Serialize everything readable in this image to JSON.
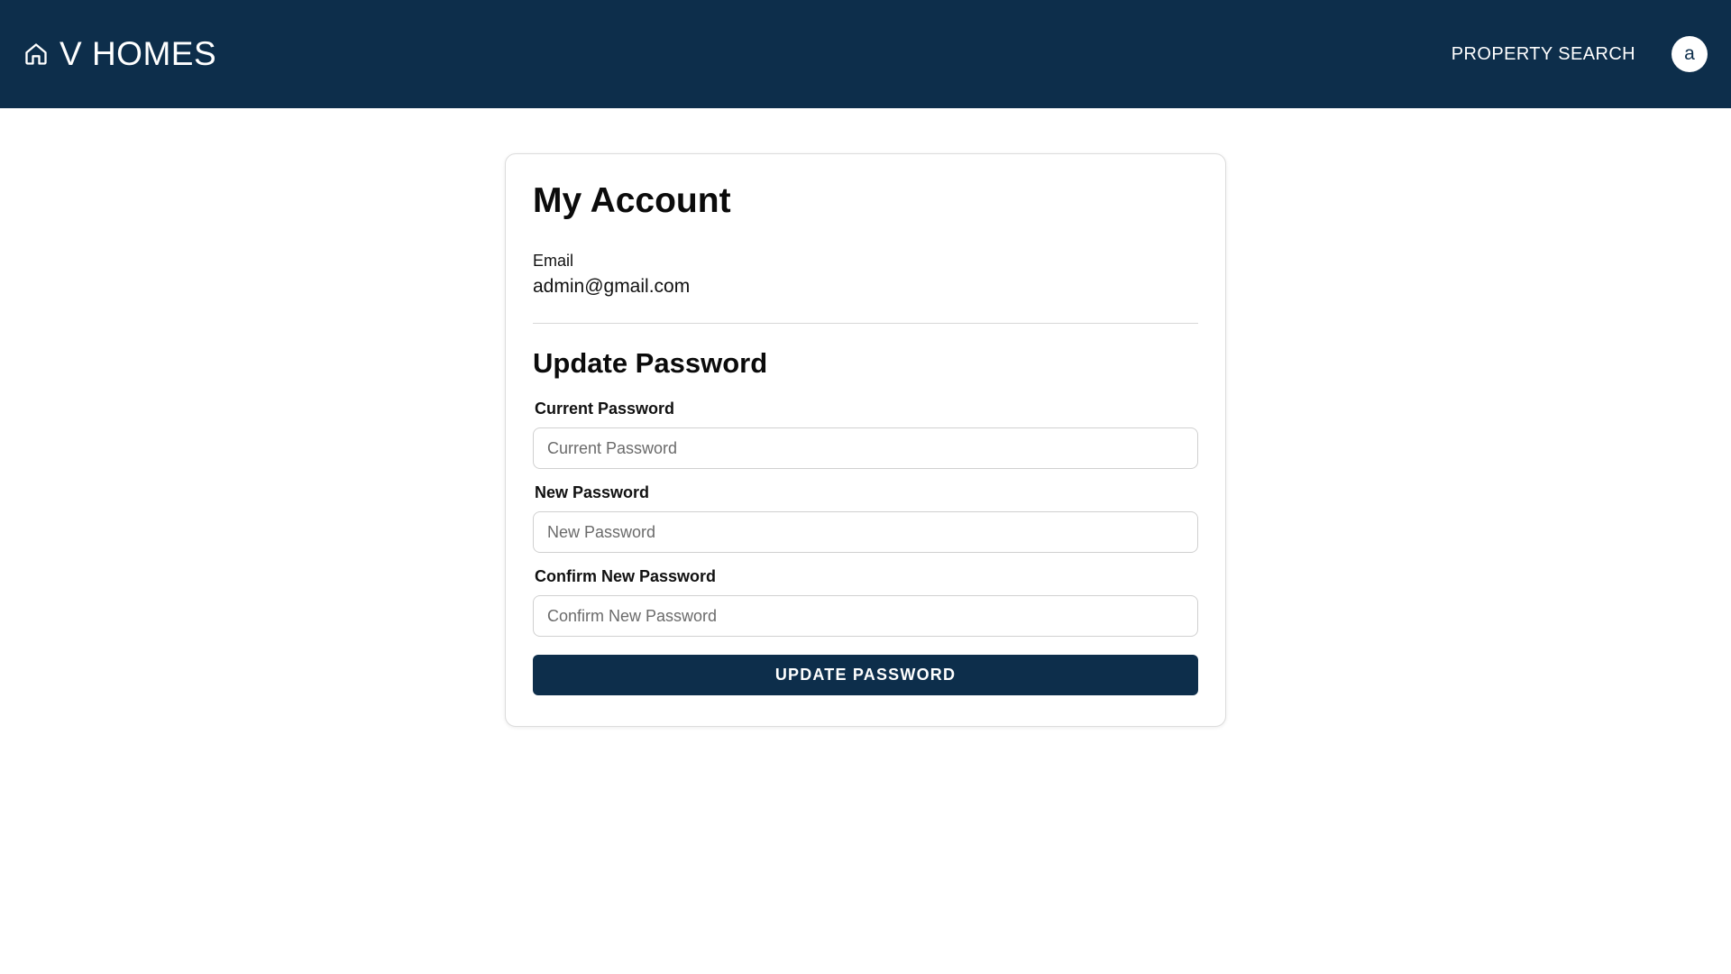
{
  "header": {
    "brand": "V HOMES",
    "brand_icon": "home-icon",
    "nav_link": "PROPERTY SEARCH",
    "avatar_initial": "a"
  },
  "colors": {
    "navbar": "#0d2e4b",
    "button": "#0d2e4b",
    "page_background": "#ffffff"
  },
  "account": {
    "title": "My Account",
    "email_label": "Email",
    "email_value": "admin@gmail.com"
  },
  "password_form": {
    "title": "Update Password",
    "fields": [
      {
        "label": "Current Password",
        "placeholder": "Current Password",
        "value": ""
      },
      {
        "label": "New Password",
        "placeholder": "New Password",
        "value": ""
      },
      {
        "label": "Confirm New Password",
        "placeholder": "Confirm New Password",
        "value": ""
      }
    ],
    "submit_label": "UPDATE PASSWORD"
  }
}
